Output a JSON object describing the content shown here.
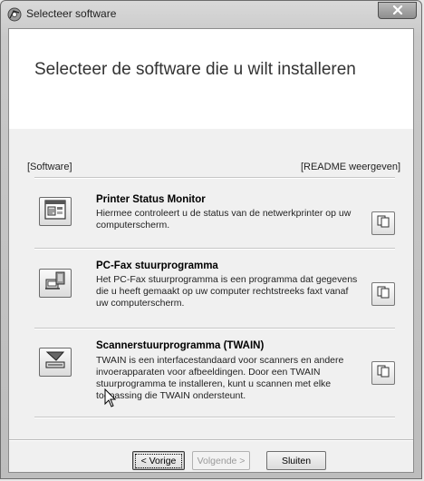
{
  "window": {
    "title": "Selecteer software",
    "close_icon": "close-icon",
    "app_icon": "installer-icon"
  },
  "header": {
    "title": "Selecteer de software die u wilt installeren"
  },
  "list": {
    "software_label": "[Software]",
    "readme_label": "[README weergeven]",
    "items": [
      {
        "title": "Printer Status Monitor",
        "description": "Hiermee controleert u de status van de netwerkprinter op uw computerscherm.",
        "icon": "printer-status-icon",
        "readme_icon": "document-icon"
      },
      {
        "title": "PC-Fax stuurprogramma",
        "description": "Het PC-Fax stuurprogramma is een programma dat  gegevens die u heeft gemaakt op uw computer rechtstreeks faxt vanaf uw computerscherm.",
        "icon": "fax-icon",
        "readme_icon": "document-icon"
      },
      {
        "title": "Scannerstuurprogramma (TWAIN)",
        "description": "TWAIN is een interfacestandaard voor scanners en andere invoerapparaten voor afbeeldingen. Door een TWAIN stuurprogramma te installeren, kunt u scannen met elke toepassing die TWAIN ondersteunt.",
        "icon": "scanner-icon",
        "readme_icon": "document-icon"
      }
    ]
  },
  "footer": {
    "back_label": "< Vorige",
    "next_label": "Volgende >",
    "close_label": "Sluiten"
  }
}
